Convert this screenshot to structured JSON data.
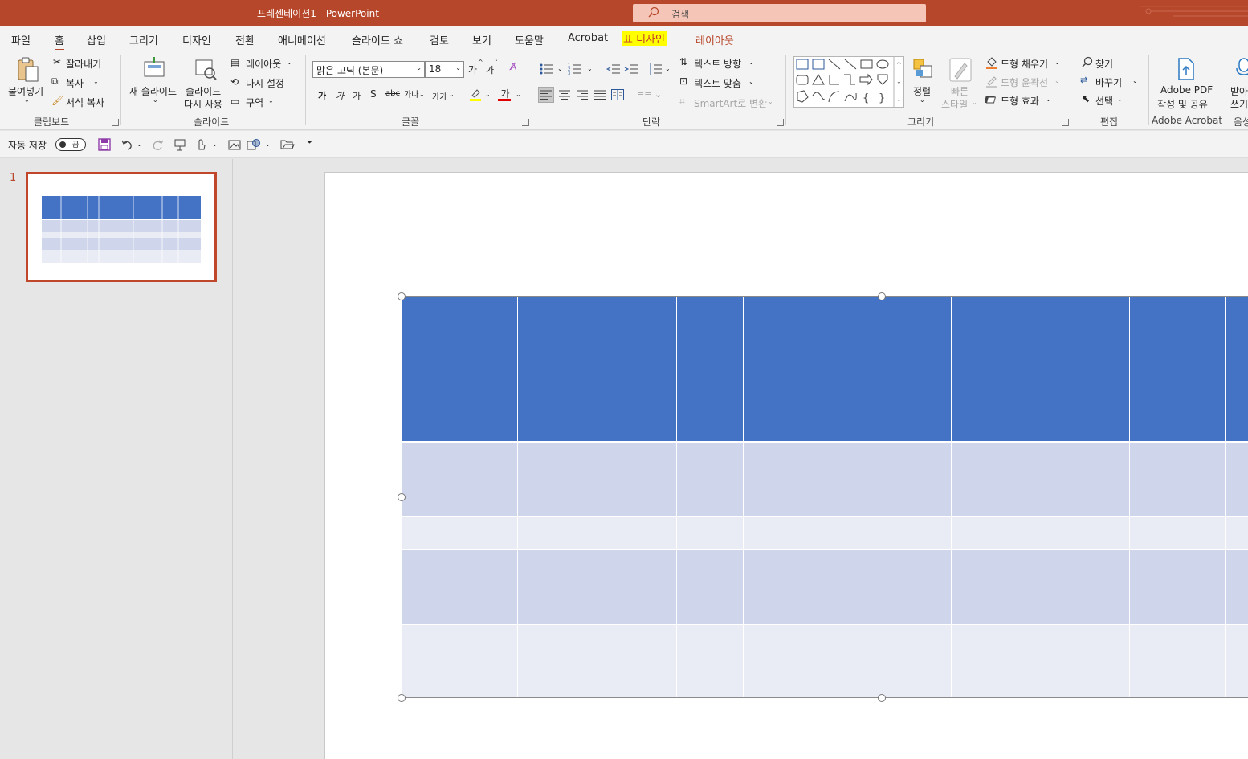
{
  "window": {
    "title": "프레젠테이션1  -  PowerPoint",
    "search_label": "검색"
  },
  "tabs": {
    "file": "파일",
    "home": "홈",
    "insert": "삽입",
    "draw": "그리기",
    "design": "디자인",
    "transitions": "전환",
    "animations": "애니메이션",
    "slideshow": "슬라이드 쇼",
    "review": "검토",
    "view": "보기",
    "help": "도움말",
    "acrobat": "Acrobat",
    "table_design": "표 디자인",
    "layout": "레이아웃"
  },
  "ribbon": {
    "clipboard": {
      "paste": "붙여넣기",
      "cut": "잘라내기",
      "copy": "복사",
      "format_painter": "서식 복사",
      "group": "클립보드"
    },
    "slides": {
      "new_slide": "새 슬라이드",
      "reuse_line1": "슬라이드",
      "reuse_line2": "다시 사용",
      "layout": "레이아웃",
      "reset": "다시 설정",
      "section": "구역",
      "group": "슬라이드"
    },
    "font": {
      "font_name": "맑은 고딕 (본문)",
      "font_size": "18",
      "grow": "가",
      "shrink": "가",
      "bold": "가",
      "italic": "가",
      "underline": "가",
      "shadow": "S",
      "strike": "abc",
      "spacing": "가나",
      "case": "가가",
      "color_letter": "가",
      "group": "글꼴"
    },
    "paragraph": {
      "text_direction": "텍스트 방향",
      "align_text": "텍스트 맞춤",
      "smartart": "SmartArt로 변환",
      "group": "단락"
    },
    "drawing": {
      "arrange": "정렬",
      "quick_styles_line1": "빠른",
      "quick_styles_line2": "스타일",
      "shape_fill": "도형 채우기",
      "shape_outline": "도형 윤곽선",
      "shape_effects": "도형 효과",
      "group": "그리기"
    },
    "editing": {
      "find": "찾기",
      "replace": "바꾸기",
      "select": "선택",
      "group": "편집"
    },
    "acrobat": {
      "pdf_line1": "Adobe PDF",
      "pdf_line2": "작성 및 공유",
      "group": "Adobe Acrobat"
    },
    "voice": {
      "dictate_line1": "받아",
      "dictate_line2": "쓰기",
      "group": "음성"
    }
  },
  "qat": {
    "autosave": "자동 저장",
    "toggle_state": "끔"
  },
  "slides_panel": {
    "slide_number": "1"
  },
  "colors": {
    "accent": "#b7472a",
    "table_header": "#4472c4",
    "table_band1": "#cfd5ea",
    "table_band2": "#e9ebf5"
  }
}
